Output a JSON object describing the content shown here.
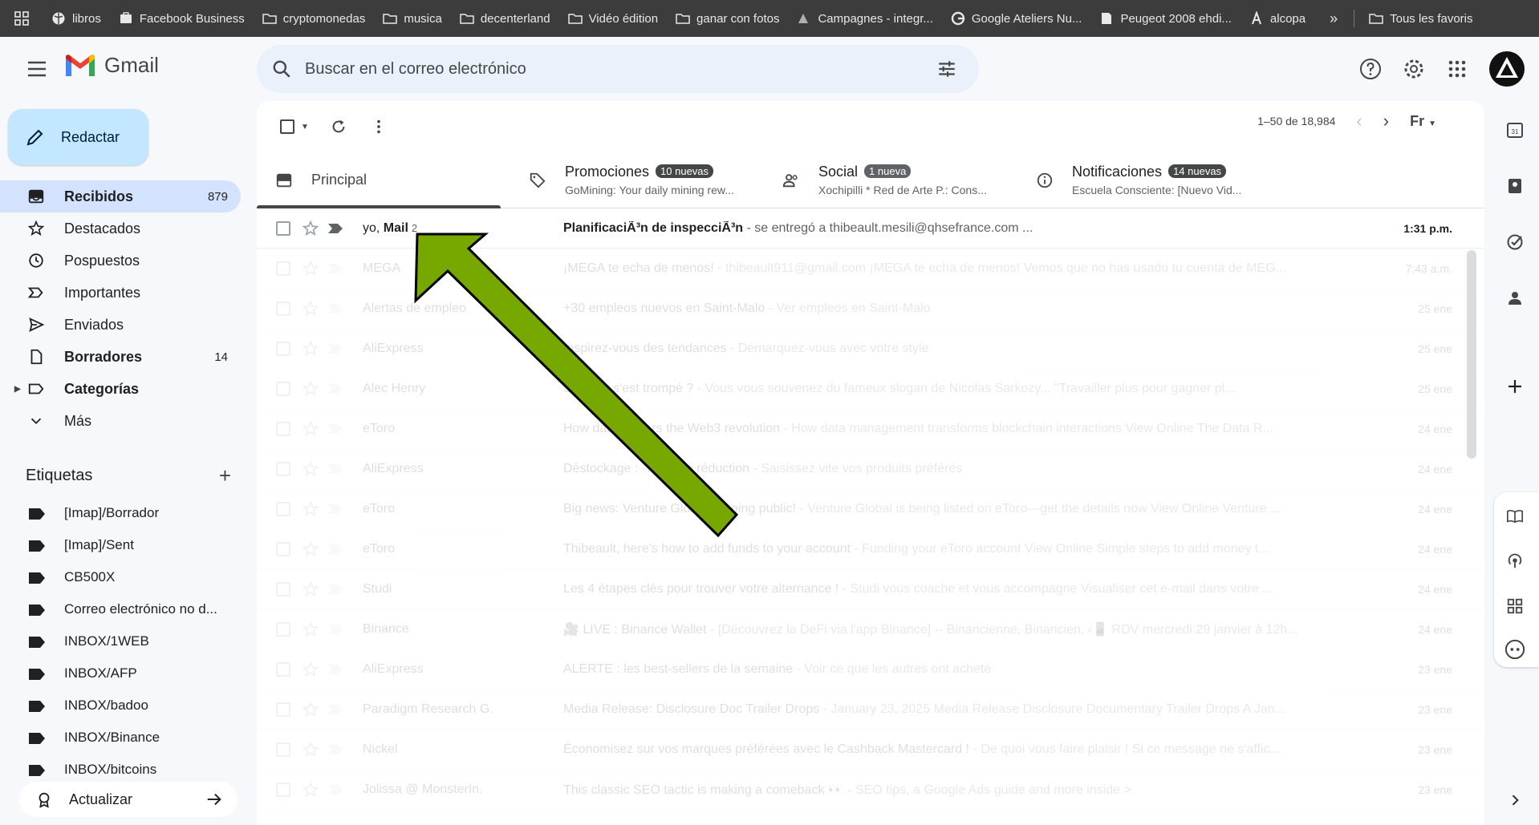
{
  "bookmarks": [
    {
      "icon": "globe-icon",
      "label": "libros"
    },
    {
      "icon": "facebook-business-icon",
      "label": "Facebook Business"
    },
    {
      "icon": "folder-icon",
      "label": "cryptomonedas"
    },
    {
      "icon": "folder-icon",
      "label": "musica"
    },
    {
      "icon": "folder-icon",
      "label": "decenterland"
    },
    {
      "icon": "folder-icon",
      "label": "Vidéo édition"
    },
    {
      "icon": "folder-icon",
      "label": "ganar con fotos"
    },
    {
      "icon": "ads-icon",
      "label": "Campagnes - integr..."
    },
    {
      "icon": "google-icon",
      "label": "Google Ateliers Nu..."
    },
    {
      "icon": "page-icon",
      "label": "Peugeot 2008 ehdi..."
    },
    {
      "icon": "alcopa-icon",
      "label": "alcopa"
    }
  ],
  "bookmarks_more": "»",
  "bookmarks_all": "Tous les favoris",
  "app": {
    "name": "Gmail"
  },
  "search": {
    "placeholder": "Buscar en el correo electrónico"
  },
  "compose": {
    "label": "Redactar"
  },
  "nav": [
    {
      "icon": "inbox-icon",
      "label": "Recibidos",
      "count": "879",
      "active": true
    },
    {
      "icon": "star-icon",
      "label": "Destacados",
      "count": ""
    },
    {
      "icon": "clock-icon",
      "label": "Pospuestos",
      "count": ""
    },
    {
      "icon": "important-icon",
      "label": "Importantes",
      "count": ""
    },
    {
      "icon": "send-icon",
      "label": "Enviados",
      "count": ""
    },
    {
      "icon": "draft-icon",
      "label": "Borradores",
      "count": "14",
      "bold": true
    },
    {
      "icon": "label-outline-icon",
      "label": "Categorías",
      "count": "",
      "bold": true,
      "expandable": true
    },
    {
      "icon": "chevron-down-icon",
      "label": "Más",
      "count": ""
    }
  ],
  "labels": {
    "title": "Etiquetas",
    "items": [
      "[Imap]/Borrador",
      "[Imap]/Sent",
      "CB500X",
      "Correo electrónico no d...",
      "INBOX/1WEB",
      "INBOX/AFP",
      "INBOX/badoo",
      "INBOX/Binance",
      "INBOX/bitcoins"
    ]
  },
  "update": {
    "label": "Actualizar"
  },
  "pager": {
    "text": "1–50 de 18,984"
  },
  "input_tools": "Fr",
  "tabs": [
    {
      "icon": "inbox-icon",
      "title": "Principal",
      "badge": "",
      "badge_color": "",
      "subtitle": "",
      "active": true
    },
    {
      "icon": "tag-icon",
      "title": "Promociones",
      "badge": "10 nuevas",
      "badge_color": "#444746",
      "subtitle": "GoMining: Your daily mining rew..."
    },
    {
      "icon": "people-icon",
      "title": "Social",
      "badge": "1 nueva",
      "badge_color": "#5f6368",
      "subtitle": "Xochipilli * Red de Arte P.: Cons..."
    },
    {
      "icon": "info-icon",
      "title": "Notificaciones",
      "badge": "14 nuevas",
      "badge_color": "#444746",
      "subtitle": "Escuela Consciente: [Nuevo Vid..."
    }
  ],
  "emails": [
    {
      "sender": "yo, ",
      "sender_bold": "Mail",
      "thread_count": "2",
      "subject": "PlanificaciÃ³n de inspecciÃ³n",
      "snippet": " - se entregó a thibeault.mesili@qhsefrance.com ...",
      "date": "1:31 p.m.",
      "unread": true
    },
    {
      "sender": "MEGA",
      "subject": "¡MEGA te echa de menos!",
      "snippet": " - thibeault911@gmail.com ¡MEGA te echa de menos! Vemos que no has usado tu cuenta de MEG...",
      "date": "7:43 a.m."
    },
    {
      "sender": "Alertas de empleo",
      "subject": "+30 empleos nuevos en Saint-Malo",
      "snippet": " - Ver empleos en Saint-Malo",
      "date": "25 ene"
    },
    {
      "sender": "AliExpress",
      "subject": "Inspirez-vous des tendances",
      "snippet": " - Démarquez-vous avec votre style",
      "date": "25 ene"
    },
    {
      "sender": "Alec Henry",
      "subject": "Sarkozy s'est trompé ?",
      "snippet": " - Vous vous souvenez du fameux slogan de Nicolas Sarkozy... \"Travailler plus pour gagner pl...",
      "date": "25 ene"
    },
    {
      "sender": "eToro",
      "subject": "How data powers the Web3 revolution",
      "snippet": " - How data management transforms blockchain interactions View Online The Data R...",
      "date": "24 ene"
    },
    {
      "sender": "AliExpress",
      "subject": "Déstockage : -75 % de réduction",
      "snippet": " - Saisissez vite vos produits préférés",
      "date": "24 ene"
    },
    {
      "sender": "eToro",
      "subject": "Big news: Venture Global is going public!",
      "snippet": " - Venture Global is being listed on eToro—get the details now View Online Venture ...",
      "date": "24 ene"
    },
    {
      "sender": "eToro",
      "subject": "Thibeault, here's how to add funds to your account",
      "snippet": " - Funding your eToro account View Online Simple steps to add money t...",
      "date": "24 ene"
    },
    {
      "sender": "Studi",
      "subject": "Les 4 étapes clés pour trouver votre alternance !",
      "snippet": " - Studi vous coache et vous accompagne Visualiser cet e-mail dans votre ...",
      "date": "24 ene"
    },
    {
      "sender": "Binance",
      "subject": "🎥 LIVE : Binance Wallet",
      "snippet": " - [Découvrez la DeFi via l'app Binance] -- Binancienne, Binancien, ‹📱 RDV mercredi 29 janvier à 12h...",
      "date": "24 ene"
    },
    {
      "sender": "AliExpress",
      "subject": "ALERTE : les best-sellers de la semaine",
      "snippet": " - Voir ce que les autres ont acheté",
      "date": "23 ene"
    },
    {
      "sender": "Paradigm Research G.",
      "subject": "Media Release: Disclosure Doc Trailer Drops",
      "snippet": " - January 23, 2025 Media Release Disclosure Documentary Trailer Drops A Jan...",
      "date": "23 ene"
    },
    {
      "sender": "Nickel",
      "subject": "Économisez sur vos marques préférées avec le Cashback Mastercard !",
      "snippet": " - De quoi vous faire plaisir ! Si ce message ne s'affic...",
      "date": "23 ene"
    },
    {
      "sender": "Jolissa @ MonsterIn.",
      "subject": "This classic SEO tactic is making a comeback 👀",
      "snippet": " - SEO tips, a Google Ads guide and more inside >",
      "date": "23 ene"
    }
  ],
  "colors": {
    "arrow_fill": "#76a800",
    "arrow_stroke": "#000000",
    "accent": "#0b57d0",
    "compose_bg": "#c2e7ff",
    "active_nav": "#d3e3fd"
  }
}
